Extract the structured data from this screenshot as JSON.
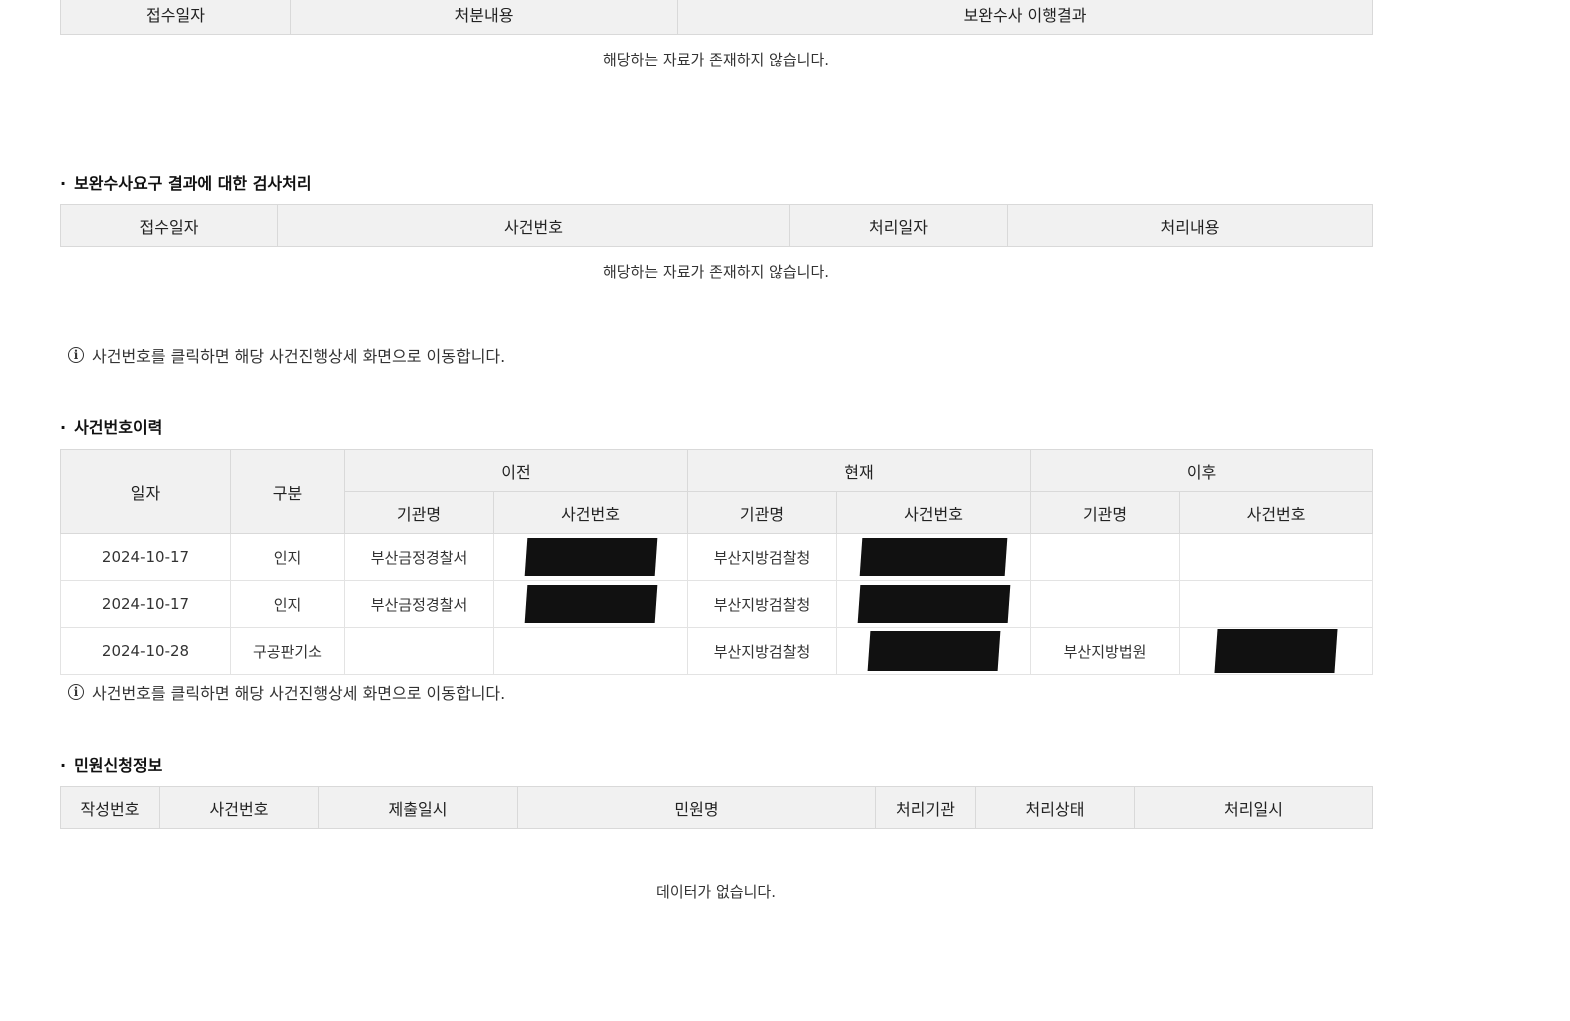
{
  "table1": {
    "headers": [
      "접수일자",
      "처분내용",
      "보완수사 이행결과"
    ],
    "empty_message": "해당하는 자료가 존재하지 않습니다."
  },
  "section2": {
    "title": "보완수사요구 결과에 대한 검사처리",
    "headers": [
      "접수일자",
      "사건번호",
      "처리일자",
      "처리내용"
    ],
    "empty_message": "해당하는 자료가 존재하지 않습니다."
  },
  "notice1": "사건번호를 클릭하면 해당 사건진행상세 화면으로 이동합니다.",
  "section3": {
    "title": "사건번호이력",
    "headers": {
      "date": "일자",
      "type": "구분",
      "before": "이전",
      "current": "현재",
      "after": "이후",
      "org": "기관명",
      "case": "사건번호"
    },
    "rows": [
      {
        "date": "2024-10-17",
        "type": "인지",
        "before_org": "부산금정경찰서",
        "current_org": "부산지방검찰청",
        "after_org": ""
      },
      {
        "date": "2024-10-17",
        "type": "인지",
        "before_org": "부산금정경찰서",
        "current_org": "부산지방검찰청",
        "after_org": ""
      },
      {
        "date": "2024-10-28",
        "type": "구공판기소",
        "before_org": "",
        "current_org": "부산지방검찰청",
        "after_org": "부산지방법원"
      }
    ]
  },
  "notice2": "사건번호를 클릭하면 해당 사건진행상세 화면으로 이동합니다.",
  "section4": {
    "title": "민원신청정보",
    "headers": [
      "작성번호",
      "사건번호",
      "제출일시",
      "민원명",
      "처리기관",
      "처리상태",
      "처리일시"
    ],
    "empty_message": "데이터가 없습니다."
  },
  "title_marker": "·",
  "info_icon": "i"
}
